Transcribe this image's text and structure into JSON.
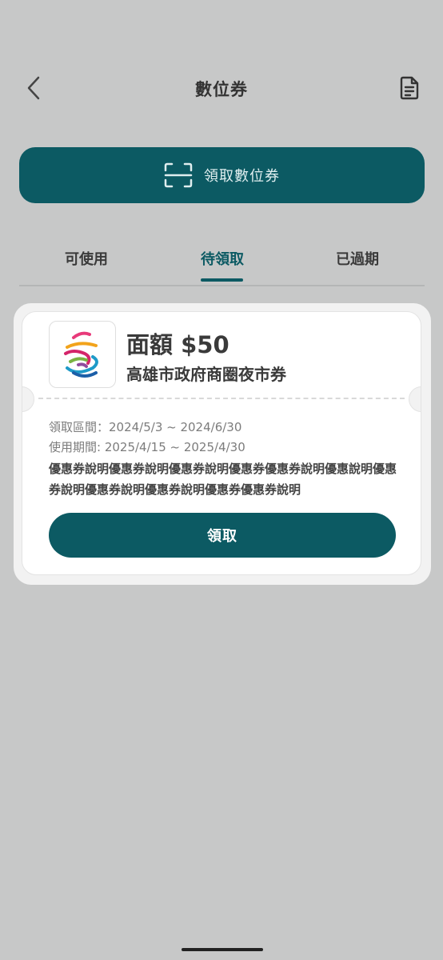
{
  "header": {
    "title": "數位券",
    "back_icon": "chevron-left-icon",
    "doc_icon": "document-icon"
  },
  "claim_button": {
    "label": "領取數位券",
    "icon": "scan-icon"
  },
  "tabs": [
    {
      "label": "可使用",
      "active": false
    },
    {
      "label": "待領取",
      "active": true
    },
    {
      "label": "已過期",
      "active": false
    }
  ],
  "voucher": {
    "amount": "面額 $50",
    "name": "高雄市政府商圈夜市券",
    "claim_period": "領取區間：2024/5/3 ~ 2024/6/30",
    "use_period": "使用期間: 2025/4/15 ~ 2025/4/30",
    "description": "優惠券說明優惠券說明優惠券說明優惠券優惠券說明優惠說明優惠券說明優惠券說明優惠券說明優惠券優惠券說明",
    "receive_label": "領取",
    "logo_icon": "kaohsiung-logo-icon"
  },
  "colors": {
    "primary": "#0c5a63",
    "background": "#c7c8c8",
    "card": "#ffffff"
  }
}
